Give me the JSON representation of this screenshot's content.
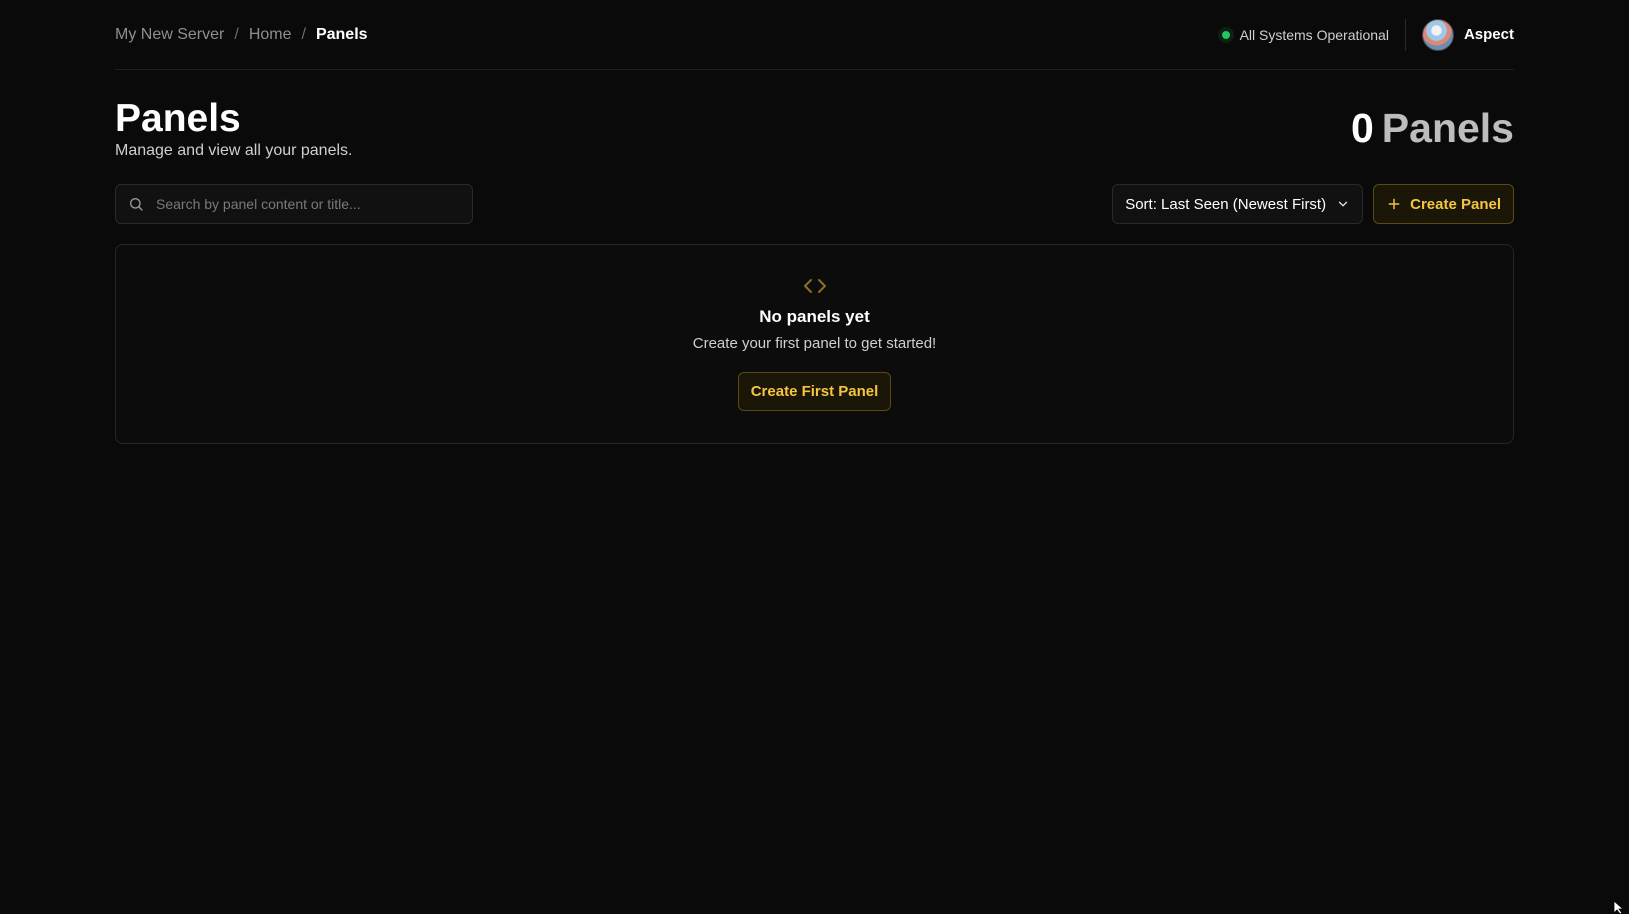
{
  "breadcrumb": {
    "items": [
      "My New Server",
      "Home",
      "Panels"
    ],
    "separator": "/"
  },
  "status": {
    "text": "All Systems Operational",
    "color": "#22c55e"
  },
  "user": {
    "name": "Aspect"
  },
  "header": {
    "title": "Panels",
    "subtitle": "Manage and view all your panels."
  },
  "count": {
    "number": "0",
    "label": "Panels"
  },
  "search": {
    "placeholder": "Search by panel content or title...",
    "value": "",
    "icon": "search-icon"
  },
  "sort": {
    "label": "Sort: Last Seen (Newest First)",
    "icon": "chevron-down-icon"
  },
  "create_button": {
    "label": "Create Panel",
    "icon": "plus-icon"
  },
  "empty_state": {
    "icon": "code-icon",
    "title": "No panels yet",
    "text": "Create your first panel to get started!",
    "button_label": "Create First Panel"
  },
  "colors": {
    "accent": "#f5c542",
    "background": "#0a0a0a"
  }
}
